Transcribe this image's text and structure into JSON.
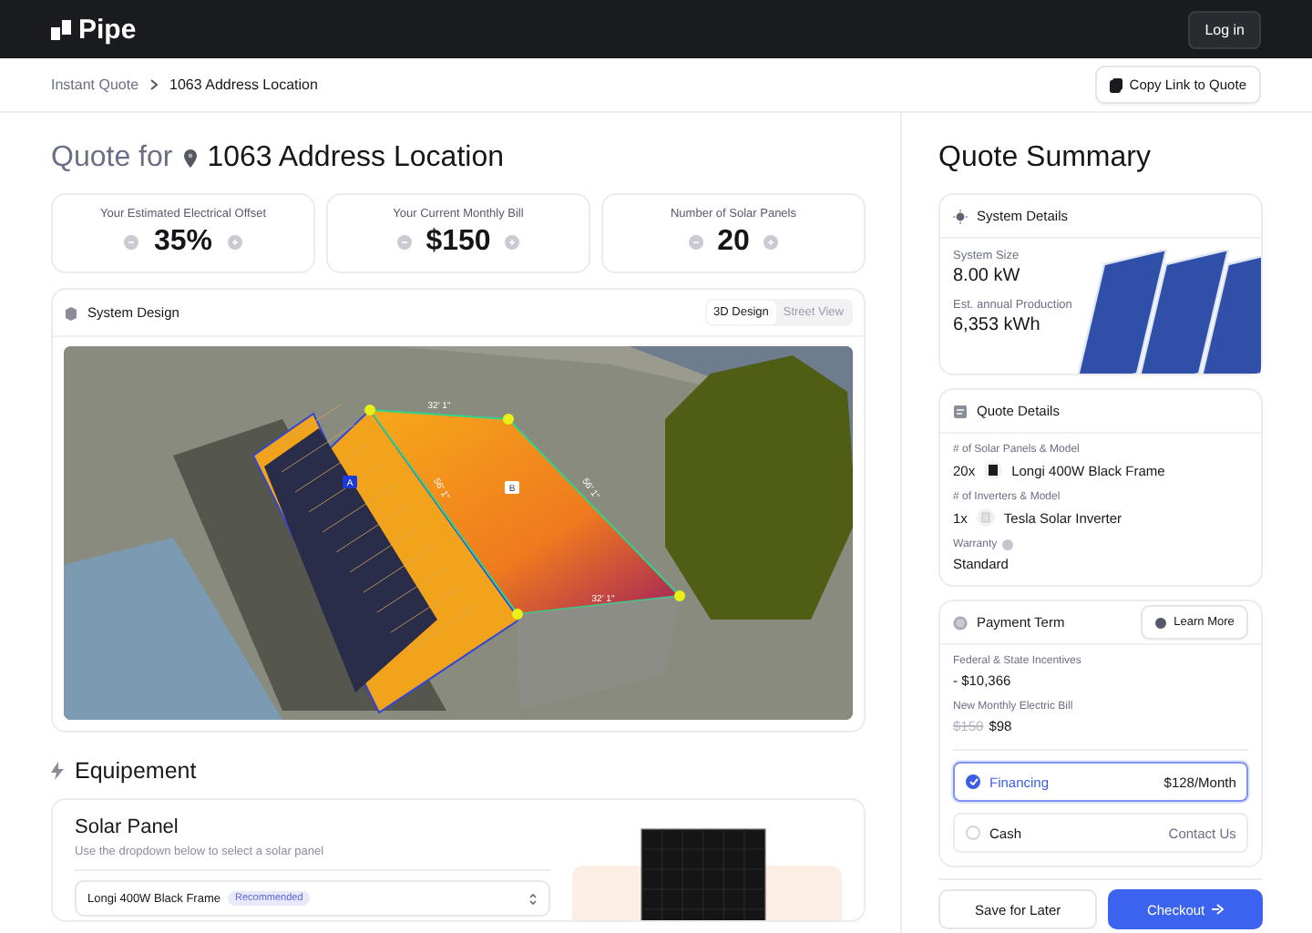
{
  "header": {
    "logo": "Pipe",
    "login_button": "Log in"
  },
  "breadcrumb": {
    "items": [
      "Instant Quote",
      "1063 Address Location"
    ],
    "copy_button": "Copy Link to Quote"
  },
  "quote": {
    "prefix": "Quote for",
    "address": "1063 Address Location"
  },
  "stats": [
    {
      "label": "Your Estimated Electrical Offset",
      "value": "35%"
    },
    {
      "label": "Your Current Monthly Bill",
      "value": "$150"
    },
    {
      "label": "Number of Solar Panels",
      "value": "20"
    }
  ],
  "system_design": {
    "title": "System Design",
    "tabs": [
      {
        "label": "3D Design",
        "selected": true
      },
      {
        "label": "Street View",
        "selected": false
      }
    ],
    "markers": [
      "A",
      "B"
    ],
    "measurements": [
      "32' 1\"",
      "56' 1\"",
      "56' 1\"",
      "32' 1\""
    ]
  },
  "equipment": {
    "title": "Equipement",
    "card": {
      "title": "Solar Panel",
      "subtitle": "Use the dropdown below to select a solar panel",
      "dropdown": {
        "value": "Longi 400W Black Frame",
        "badge": "Recommended"
      }
    }
  },
  "summary": {
    "title": "Quote Summary",
    "system_details": {
      "title": "System Details",
      "fields": [
        {
          "label": "System Size",
          "value": "8.00 kW"
        },
        {
          "label": "Est. annual Production",
          "value": "6,353 kWh"
        }
      ]
    },
    "quote_details": {
      "title": "Quote Details",
      "items": [
        {
          "label": "# of Solar Panels & Model",
          "qty": "20x",
          "model": "Longi 400W Black Frame",
          "kind": "panel"
        },
        {
          "label": "# of Inverters & Model",
          "qty": "1x",
          "model": "Tesla Solar Inverter",
          "kind": "inverter"
        }
      ],
      "warranty": {
        "label": "Warranty",
        "value": "Standard"
      }
    },
    "payment_term": {
      "title": "Payment Term",
      "learn_more": "Learn More",
      "incentives": {
        "label": "Federal & State Incentives",
        "value": "- $10,366"
      },
      "bill": {
        "label": "New Monthly Electric Bill",
        "old": "$150",
        "new": "$98"
      },
      "options": [
        {
          "label": "Financing",
          "price": "$128/Month",
          "selected": true
        },
        {
          "label": "Cash",
          "price": "Contact Us",
          "selected": false
        }
      ]
    },
    "buttons": {
      "save": "Save for Later",
      "checkout": "Checkout"
    }
  }
}
